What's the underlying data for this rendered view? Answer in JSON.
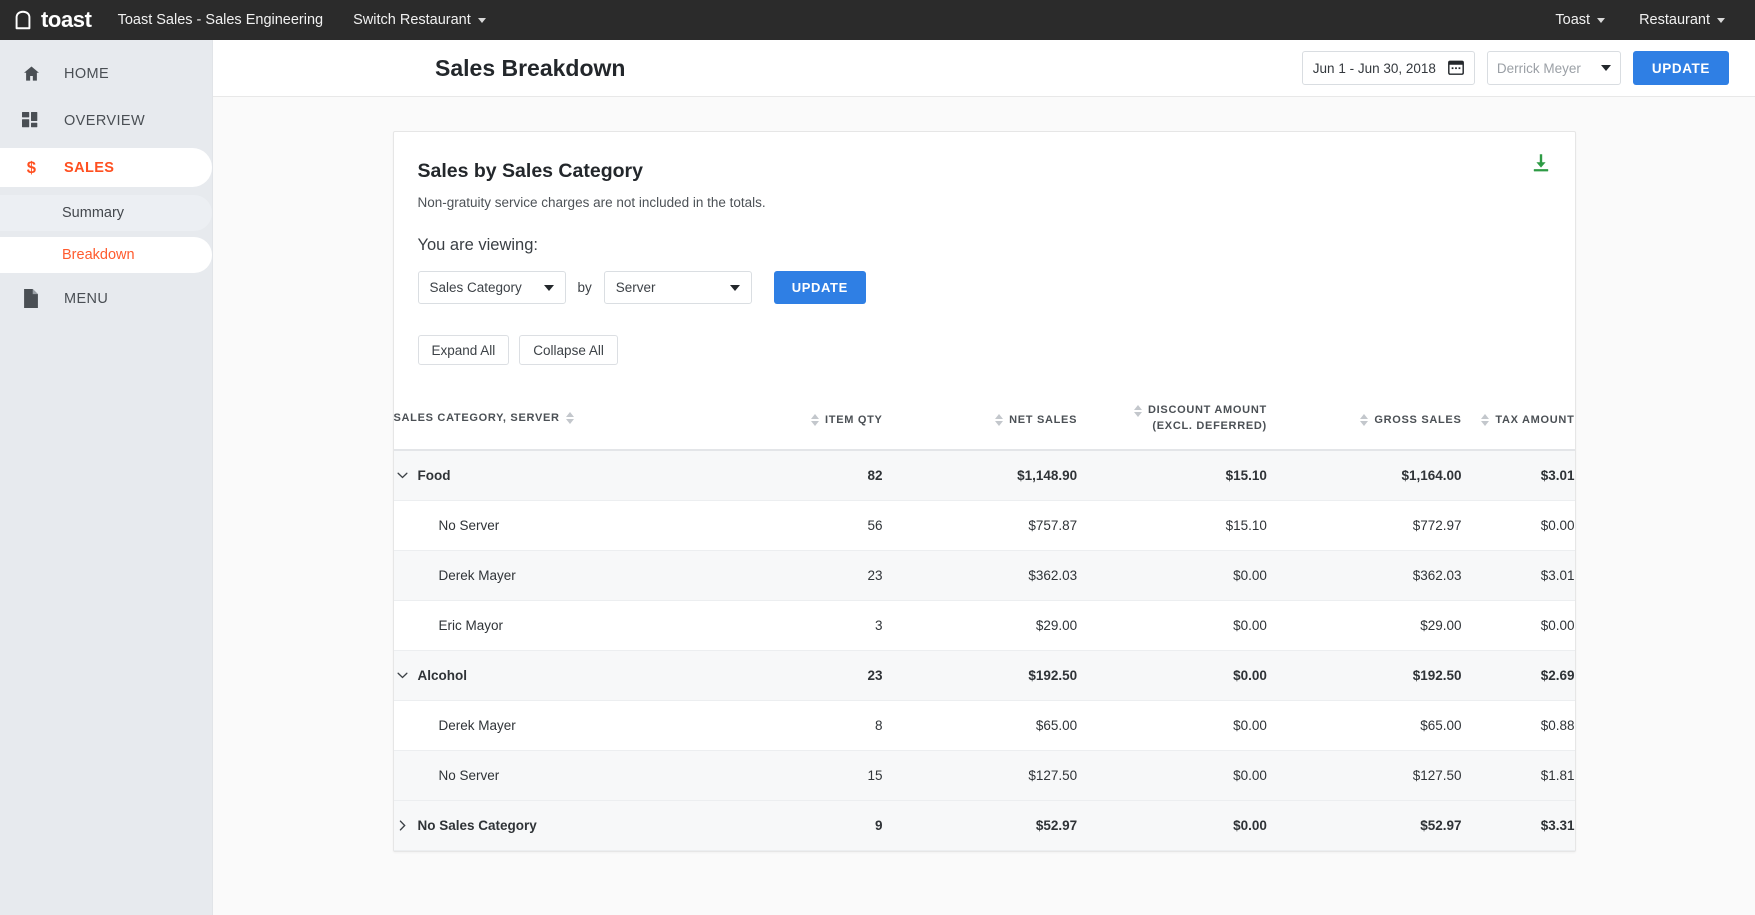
{
  "topnav": {
    "brand": "toast",
    "restaurant_label": "Toast Sales - Sales Engineering",
    "switch_restaurant": "Switch Restaurant",
    "account_menu": "Toast",
    "restaurant_menu": "Restaurant"
  },
  "sidebar": {
    "items": [
      {
        "label": "HOME",
        "icon": "home-icon"
      },
      {
        "label": "OVERVIEW",
        "icon": "grid-icon"
      },
      {
        "label": "SALES",
        "icon": "dollar-icon"
      },
      {
        "label": "MENU",
        "icon": "document-icon"
      }
    ],
    "sub_items": [
      {
        "label": "Summary"
      },
      {
        "label": "Breakdown"
      }
    ]
  },
  "page": {
    "title": "Sales Breakdown",
    "date_range": "Jun 1 - Jun 30, 2018",
    "server_placeholder": "Derrick Meyer",
    "update_label": "UPDATE"
  },
  "card": {
    "title": "Sales by Sales Category",
    "subtitle": "Non-gratuity service charges are not included in the totals.",
    "viewing_label": "You are viewing:",
    "dimension": "Sales Category",
    "by_word": "by",
    "group_by": "Server",
    "update_label": "UPDATE",
    "expand_all": "Expand All",
    "collapse_all": "Collapse All",
    "download_icon": "download-icon"
  },
  "table": {
    "columns": [
      "SALES CATEGORY, SERVER",
      "ITEM QTY",
      "NET SALES",
      "DISCOUNT AMOUNT",
      "(EXCL. DEFERRED)",
      "GROSS SALES",
      "TAX AMOUNT"
    ],
    "rows": [
      {
        "name": "Food",
        "type": "group",
        "expanded": true,
        "qty": "82",
        "net": "$1,148.90",
        "discount": "$15.10",
        "gross": "$1,164.00",
        "tax": "$3.01"
      },
      {
        "name": "No Server",
        "type": "child",
        "qty": "56",
        "net": "$757.87",
        "discount": "$15.10",
        "gross": "$772.97",
        "tax": "$0.00"
      },
      {
        "name": "Derek Mayer",
        "type": "child",
        "qty": "23",
        "net": "$362.03",
        "discount": "$0.00",
        "gross": "$362.03",
        "tax": "$3.01"
      },
      {
        "name": "Eric Mayor",
        "type": "child",
        "qty": "3",
        "net": "$29.00",
        "discount": "$0.00",
        "gross": "$29.00",
        "tax": "$0.00"
      },
      {
        "name": "Alcohol",
        "type": "group",
        "expanded": true,
        "qty": "23",
        "net": "$192.50",
        "discount": "$0.00",
        "gross": "$192.50",
        "tax": "$2.69"
      },
      {
        "name": "Derek Mayer",
        "type": "child",
        "qty": "8",
        "net": "$65.00",
        "discount": "$0.00",
        "gross": "$65.00",
        "tax": "$0.88"
      },
      {
        "name": "No Server",
        "type": "child",
        "qty": "15",
        "net": "$127.50",
        "discount": "$0.00",
        "gross": "$127.50",
        "tax": "$1.81"
      },
      {
        "name": "No Sales Category",
        "type": "group",
        "expanded": false,
        "qty": "9",
        "net": "$52.97",
        "discount": "$0.00",
        "gross": "$52.97",
        "tax": "$3.31"
      }
    ]
  },
  "colors": {
    "accent_orange": "#ff5b2e",
    "primary_blue": "#2f7fe4",
    "topnav_bg": "#2b2b2b",
    "sidebar_bg": "#e7eaee",
    "download_green": "#2e9b45"
  }
}
